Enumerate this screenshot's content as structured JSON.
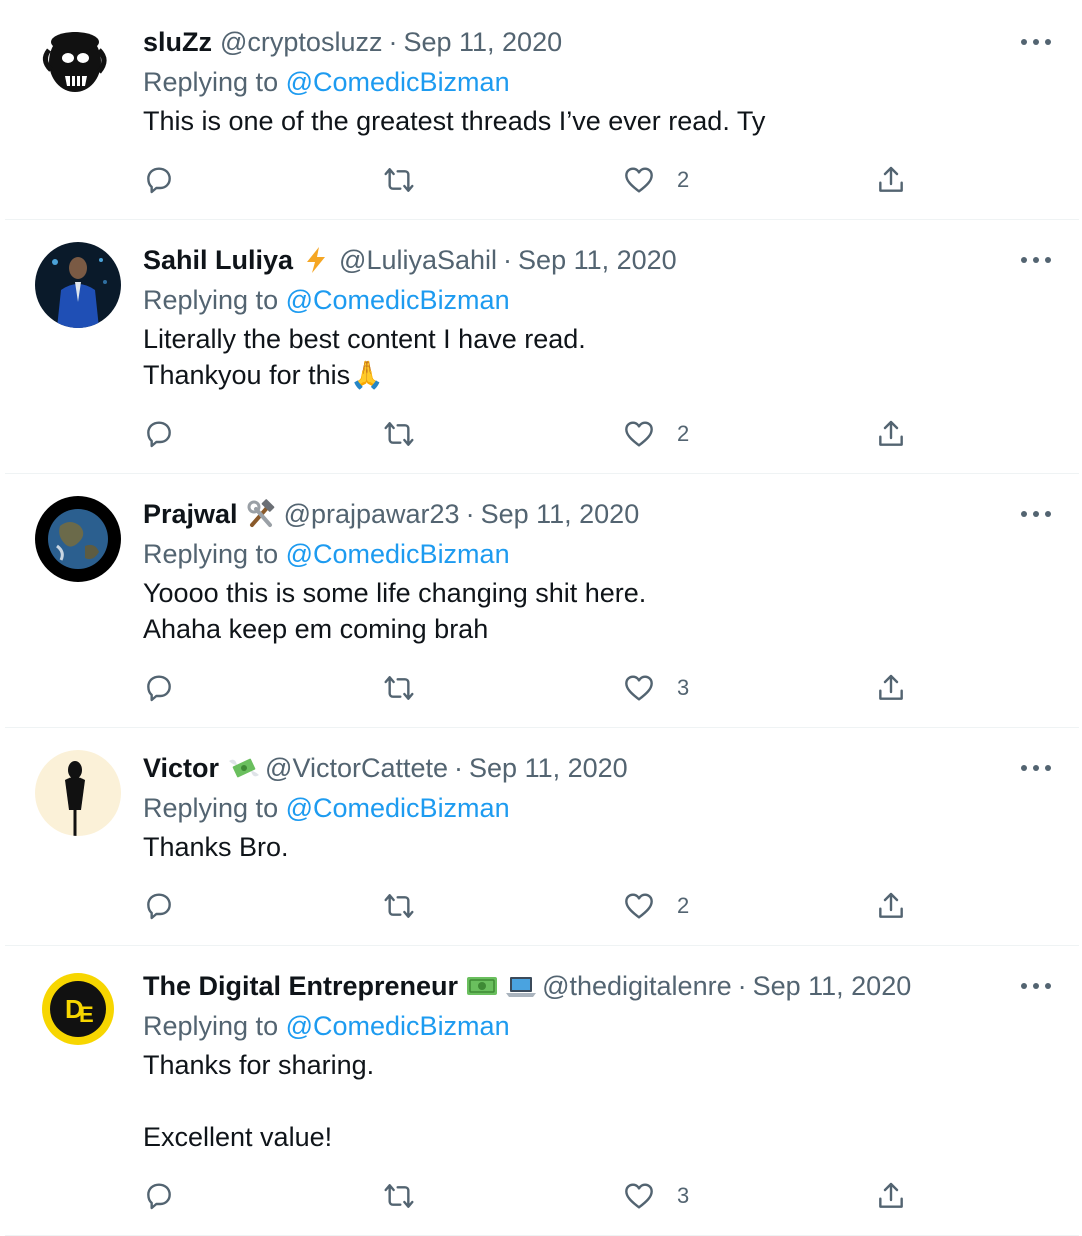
{
  "reply_prefix": "Replying to",
  "tweets": [
    {
      "name": "sluZz",
      "badges": [],
      "handle": "@cryptosluzz",
      "separator": "·",
      "date": "Sep 11, 2020",
      "replying_to": "@ComedicBizman",
      "text": "This is one of the greatest threads I’ve ever read. Ty",
      "likes": "2"
    },
    {
      "name": "Sahil Luliya",
      "badges": [
        "lightning-emoji"
      ],
      "handle": "@LuliyaSahil",
      "separator": "·",
      "date": "Sep 11, 2020",
      "replying_to": "@ComedicBizman",
      "text": "Literally the best content I have read.\nThankyou for this🙏",
      "likes": "2"
    },
    {
      "name": "Prajwal",
      "badges": [
        "hammer-wrench-emoji"
      ],
      "handle": "@prajpawar23",
      "separator": "·",
      "date": "Sep 11, 2020",
      "replying_to": "@ComedicBizman",
      "text": "Yoooo this is some life changing shit here.\nAhaha keep em coming brah",
      "likes": "3"
    },
    {
      "name": "Victor",
      "badges": [
        "money-with-wings-emoji"
      ],
      "handle": "@VictorCattete",
      "separator": "·",
      "date": "Sep 11, 2020",
      "replying_to": "@ComedicBizman",
      "text": "Thanks Bro.",
      "likes": "2"
    },
    {
      "name": "The Digital Entrepreneur",
      "badges": [
        "dollar-banknote-emoji",
        "laptop-emoji"
      ],
      "handle": "@thedigitalenre",
      "separator": "·",
      "date": "Sep 11, 2020",
      "replying_to": "@ComedicBizman",
      "text": "Thanks for sharing.\n\nExcellent value!",
      "likes": "3"
    }
  ],
  "colors": {
    "accent": "#1d9bf0",
    "secondary_text": "#536471",
    "primary_text": "#0f1419",
    "divider": "#eff3f4"
  }
}
